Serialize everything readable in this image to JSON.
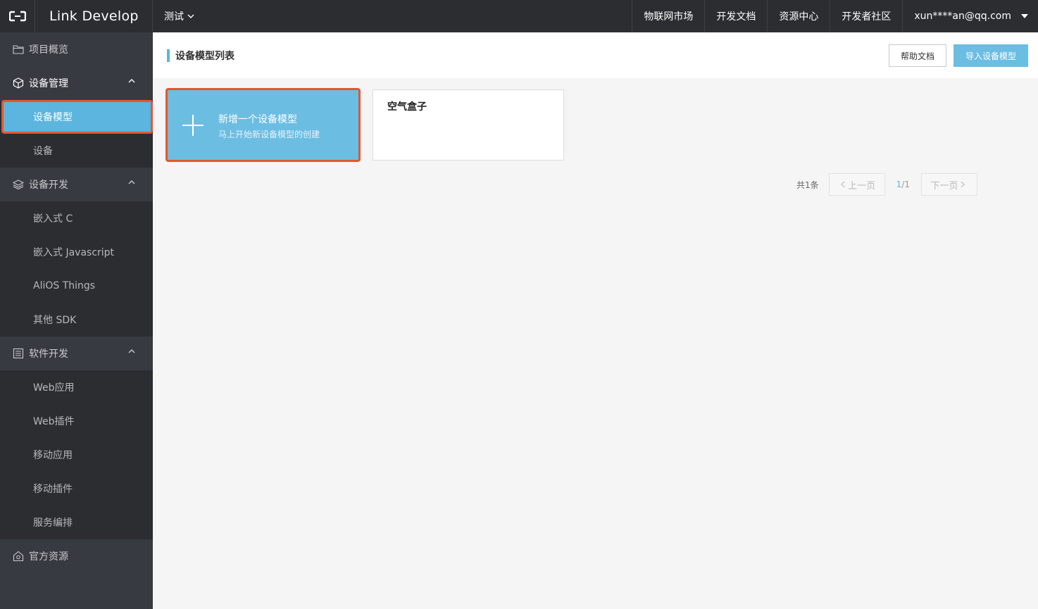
{
  "topbar": {
    "brand": "Link Develop",
    "project": "测试",
    "nav": [
      "物联网市场",
      "开发文档",
      "资源中心",
      "开发者社区"
    ],
    "user": "xun****an@qq.com"
  },
  "sidebar": {
    "overview": "项目概览",
    "device_mgmt": "设备管理",
    "device_mgmt_items": [
      "设备模型",
      "设备"
    ],
    "device_dev": "设备开发",
    "device_dev_items": [
      "嵌入式 C",
      "嵌入式 Javascript",
      "AliOS Things",
      "其他 SDK"
    ],
    "software_dev": "软件开发",
    "software_dev_items": [
      "Web应用",
      "Web插件",
      "移动应用",
      "移动插件",
      "服务编排"
    ],
    "official": "官方资源"
  },
  "main": {
    "title": "设备模型列表",
    "help_btn": "帮助文档",
    "import_btn": "导入设备模型",
    "add_card": {
      "title": "新增一个设备模型",
      "subtitle": "马上开始新设备模型的创建"
    },
    "models": [
      "空气盒子"
    ],
    "pager": {
      "total": "共1条",
      "prev": "上一页",
      "current": "1",
      "sep": "/1",
      "next": "下一页"
    }
  },
  "colors": {
    "accent": "#6cbde2",
    "highlight": "#e4562e",
    "topbar": "#2b2d31",
    "sidebar": "#373a40"
  }
}
